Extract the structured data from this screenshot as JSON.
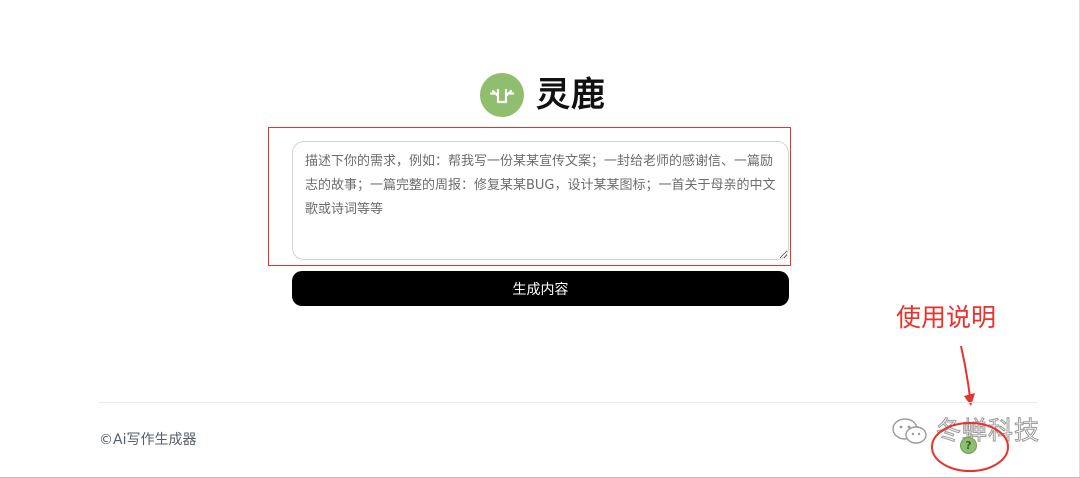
{
  "logo": {
    "text": "灵鹿",
    "icon": "deer-antler-icon",
    "icon_bg": "#8fbe6f"
  },
  "prompt": {
    "placeholder": "描述下你的需求，例如：帮我写一份某某宣传文案；一封给老师的感谢信、一篇励志的故事；一篇完整的周报：修复某某BUG，设计某某图标；一首关于母亲的中文歌或诗词等等",
    "value": ""
  },
  "generate_button": {
    "label": "生成内容",
    "bg": "#000000"
  },
  "annotation": {
    "label": "使用说明",
    "color": "#e8332b"
  },
  "footer": {
    "copyright": "©Ai写作生成器",
    "help": {
      "symbol": "?",
      "icon": "question-mark-icon"
    }
  },
  "watermark": {
    "text": "冬蝉科技",
    "icon": "wechat-icon"
  }
}
